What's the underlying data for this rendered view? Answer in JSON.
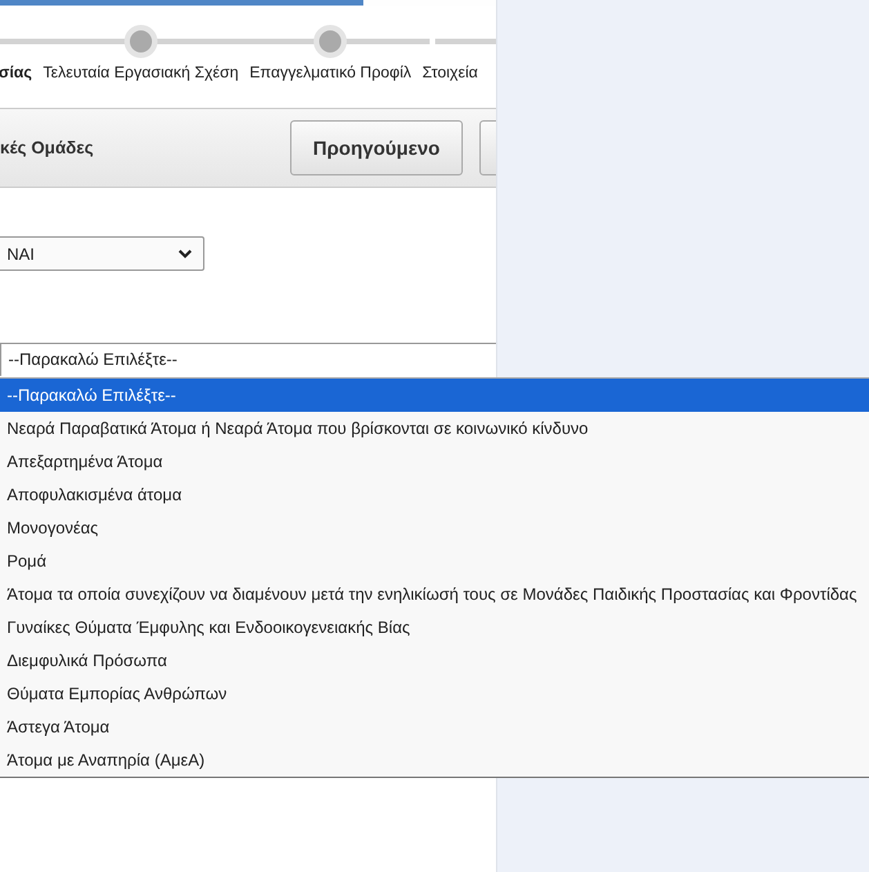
{
  "progress": {
    "level": 0.73
  },
  "stepper": [
    {
      "label": "σίας",
      "current": true,
      "marker": false
    },
    {
      "label": "Τελευταία Εργασιακή Σχέση",
      "current": false,
      "marker": true
    },
    {
      "label": "Επαγγελματικό Προφίλ",
      "current": false,
      "marker": true
    },
    {
      "label": "Στοιχεία",
      "current": false,
      "marker": false
    }
  ],
  "toolbar": {
    "title": "κές Ομάδες",
    "buttons": [
      "Προηγούμενο"
    ]
  },
  "yes_no_select": {
    "value": "NAI"
  },
  "group_select": {
    "value": "--Παρακαλώ Επιλέξτε--"
  },
  "dropdown_options": [
    {
      "label": "--Παρακαλώ Επιλέξτε--",
      "selected": true
    },
    {
      "label": "Νεαρά Παραβατικά Άτομα ή Νεαρά Άτομα που βρίσκονται σε κοινωνικό κίνδυνο",
      "selected": false
    },
    {
      "label": "Απεξαρτημένα Άτομα",
      "selected": false
    },
    {
      "label": "Αποφυλακισμένα άτομα",
      "selected": false
    },
    {
      "label": "Μονογονέας",
      "selected": false
    },
    {
      "label": "Ρομά",
      "selected": false
    },
    {
      "label": "Άτομα τα οποία συνεχίζουν να διαμένουν μετά την ενηλικίωσή τους σε Μονάδες Παιδικής Προστασίας και Φροντίδας",
      "selected": false
    },
    {
      "label": "Γυναίκες Θύματα Έμφυλης και Ενδοοικογενειακής Βίας",
      "selected": false
    },
    {
      "label": "Διεμφυλικά Πρόσωπα",
      "selected": false
    },
    {
      "label": "Θύματα Εμπορίας Ανθρώπων",
      "selected": false
    },
    {
      "label": "Άστεγα Άτομα",
      "selected": false
    },
    {
      "label": "Άτομα με Αναπηρία (ΑμεΑ)",
      "selected": false
    }
  ]
}
